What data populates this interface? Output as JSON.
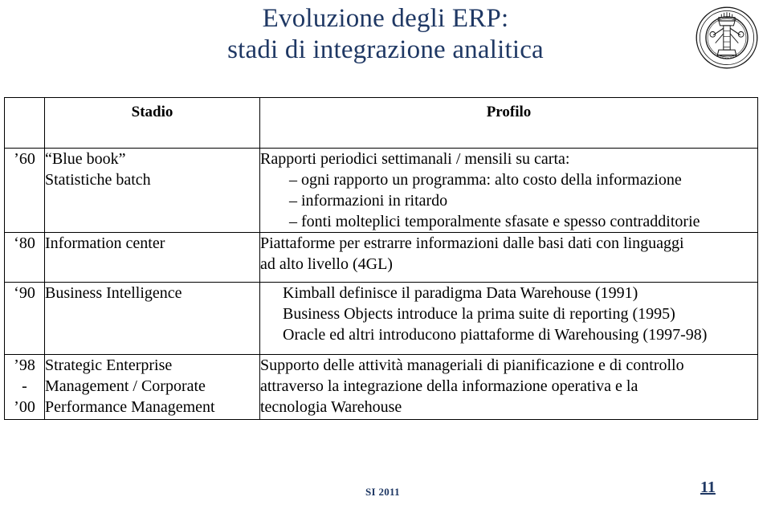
{
  "slide": {
    "title_line1": "Evoluzione degli ERP:",
    "title_line2": "stadi di integrazione analitica",
    "title_color": "#1F3864",
    "logo_name": "university-seal-logo"
  },
  "table": {
    "headers": {
      "year": "",
      "stage": "Stadio",
      "profile": "Profilo"
    },
    "rows": [
      {
        "year_lines": [
          "’60"
        ],
        "stage_lines": [
          "“Blue book”",
          "Statistiche batch"
        ],
        "profile_lines": [
          {
            "text": "Rapporti periodici settimanali / mensili su carta:",
            "indent": "none"
          },
          {
            "text": "– ogni rapporto un programma: alto costo della informazione",
            "indent": "indent1"
          },
          {
            "text": "– informazioni in ritardo",
            "indent": "indent1"
          },
          {
            "text": "– fonti molteplici temporalmente sfasate e spesso contradditorie",
            "indent": "indent1"
          }
        ]
      },
      {
        "year_lines": [
          "‘80"
        ],
        "stage_lines": [
          "Information center"
        ],
        "profile_lines": [
          {
            "text": "Piattaforme per estrarre informazioni dalle basi dati con linguaggi",
            "indent": "none"
          },
          {
            "text": "ad alto livello (4GL)",
            "indent": "none"
          }
        ]
      },
      {
        "year_lines": [
          "‘90"
        ],
        "stage_lines": [
          "Business Intelligence"
        ],
        "profile_lines": [
          {
            "text": "Kimball definisce il paradigma Data Warehouse (1991)",
            "indent": "center"
          },
          {
            "text": "Business Objects introduce la prima suite di reporting (1995)",
            "indent": "center"
          },
          {
            "text": "Oracle ed altri introducono piattaforme di Warehousing (1997-98)",
            "indent": "center"
          }
        ]
      },
      {
        "year_lines": [
          "’98",
          "-",
          "’00"
        ],
        "stage_lines": [
          "Strategic Enterprise",
          "Management / Corporate",
          "Performance Management"
        ],
        "profile_lines": [
          {
            "text": "Supporto delle attività manageriali di pianificazione e di controllo",
            "indent": "none"
          },
          {
            "text": "attraverso la integrazione della informazione operativa e la",
            "indent": "none"
          },
          {
            "text": "tecnologia Warehouse",
            "indent": "none"
          }
        ]
      }
    ]
  },
  "footer": {
    "course_label": "SI 2011",
    "page_number": "11",
    "color": "#1F3864"
  }
}
